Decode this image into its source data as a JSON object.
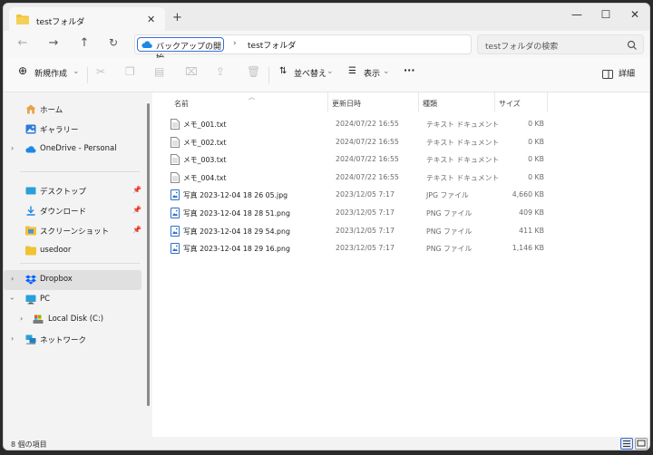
{
  "tab": {
    "title": "testフォルダ",
    "close": "✕",
    "new_tab": "+"
  },
  "window_controls": {
    "minimize": "—",
    "maximize": "☐",
    "close": "✕"
  },
  "nav": {
    "back": "←",
    "forward": "→",
    "up": "↑",
    "refresh": "↻"
  },
  "breadcrumb": {
    "items": [
      "バックアップの開始",
      "testフォルダ"
    ],
    "separator": "›"
  },
  "search": {
    "placeholder": "testフォルダの検索",
    "icon": "search-icon"
  },
  "toolbar": {
    "new_label": "新規作成",
    "new_icon": "⊕",
    "sort_label": "並べ替え",
    "view_label": "表示",
    "more_label": "···",
    "details_label": "詳細",
    "disabled_icons": [
      "cut-icon",
      "copy-icon",
      "paste-icon",
      "rename-icon",
      "share-icon",
      "delete-icon"
    ]
  },
  "sidebar": {
    "quick": [
      {
        "label": "ホーム",
        "icon": "home-icon"
      },
      {
        "label": "ギャラリー",
        "icon": "gallery-icon"
      },
      {
        "label": "OneDrive - Personal",
        "icon": "cloud-icon"
      }
    ],
    "pinned": [
      {
        "label": "デスクトップ",
        "icon": "desktop-icon"
      },
      {
        "label": "ダウンロード",
        "icon": "download-icon"
      },
      {
        "label": "スクリーンショット",
        "icon": "screenshot-folder-icon"
      },
      {
        "label": "usedoor",
        "icon": "folder-icon"
      }
    ],
    "drives": [
      {
        "label": "Dropbox",
        "icon": "dropbox-icon",
        "selected": true
      },
      {
        "label": "PC",
        "icon": "pc-icon"
      },
      {
        "label": "Local Disk (C:)",
        "icon": "disk-icon"
      },
      {
        "label": "ネットワーク",
        "icon": "network-icon"
      }
    ]
  },
  "columns": {
    "name": "名前",
    "date": "更新日時",
    "type": "種類",
    "size": "サイズ"
  },
  "files": [
    {
      "name": "メモ_001.txt",
      "date": "2024/07/22 16:55",
      "type": "テキスト ドキュメント",
      "size": "0 KB",
      "icon": "text-file-icon"
    },
    {
      "name": "メモ_002.txt",
      "date": "2024/07/22 16:55",
      "type": "テキスト ドキュメント",
      "size": "0 KB",
      "icon": "text-file-icon"
    },
    {
      "name": "メモ_003.txt",
      "date": "2024/07/22 16:55",
      "type": "テキスト ドキュメント",
      "size": "0 KB",
      "icon": "text-file-icon"
    },
    {
      "name": "メモ_004.txt",
      "date": "2024/07/22 16:55",
      "type": "テキスト ドキュメント",
      "size": "0 KB",
      "icon": "text-file-icon"
    },
    {
      "name": "写真 2023-12-04 18 26 05.jpg",
      "date": "2023/12/05 7:17",
      "type": "JPG ファイル",
      "size": "4,660 KB",
      "icon": "image-file-icon"
    },
    {
      "name": "写真 2023-12-04 18 28 51.png",
      "date": "2023/12/05 7:17",
      "type": "PNG ファイル",
      "size": "409 KB",
      "icon": "image-file-icon"
    },
    {
      "name": "写真 2023-12-04 18 29 54.png",
      "date": "2023/12/05 7:17",
      "type": "PNG ファイル",
      "size": "411 KB",
      "icon": "image-file-icon"
    },
    {
      "name": "写真 2023-12-04 18 29 16.png",
      "date": "2023/12/05 7:17",
      "type": "PNG ファイル",
      "size": "1,146 KB",
      "icon": "image-file-icon"
    }
  ],
  "status": {
    "count_text": "8 個の項目"
  },
  "colors": {
    "accent": "#3a6fd8",
    "folder": "#f1c232",
    "onedrive": "#1e88e5"
  }
}
